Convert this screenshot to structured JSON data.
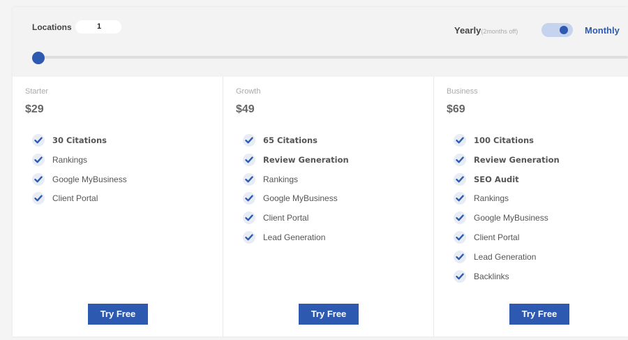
{
  "colors": {
    "accent": "#2d5ab0",
    "toggle_track": "#c5d3ef",
    "background": "#f4f4f4",
    "card": "#ffffff"
  },
  "locations": {
    "label": "Locations",
    "value": "1"
  },
  "billing": {
    "yearly_label": "Yearly",
    "yearly_note": "(2months off)",
    "monthly_label": "Monthly",
    "selected": "Monthly"
  },
  "slider": {
    "value": 1
  },
  "plans": [
    {
      "name": "Starter",
      "price": "$29",
      "features": [
        {
          "text": "30 Citations",
          "bold": true
        },
        {
          "text": "Rankings",
          "bold": false
        },
        {
          "text": "Google MyBusiness",
          "bold": false
        },
        {
          "text": "Client Portal",
          "bold": false
        }
      ],
      "button": "Try Free"
    },
    {
      "name": "Growth",
      "price": "$49",
      "features": [
        {
          "text": "65 Citations",
          "bold": true
        },
        {
          "text": "Review Generation",
          "bold": true
        },
        {
          "text": "Rankings",
          "bold": false
        },
        {
          "text": "Google MyBusiness",
          "bold": false
        },
        {
          "text": "Client Portal",
          "bold": false
        },
        {
          "text": "Lead Generation",
          "bold": false
        }
      ],
      "button": "Try Free"
    },
    {
      "name": "Business",
      "price": "$69",
      "features": [
        {
          "text": "100 Citations",
          "bold": true
        },
        {
          "text": "Review Generation",
          "bold": true
        },
        {
          "text": "SEO Audit",
          "bold": true
        },
        {
          "text": "Rankings",
          "bold": false
        },
        {
          "text": "Google MyBusiness",
          "bold": false
        },
        {
          "text": "Client Portal",
          "bold": false
        },
        {
          "text": "Lead Generation",
          "bold": false
        },
        {
          "text": "Backlinks",
          "bold": false
        }
      ],
      "button": "Try Free"
    }
  ]
}
